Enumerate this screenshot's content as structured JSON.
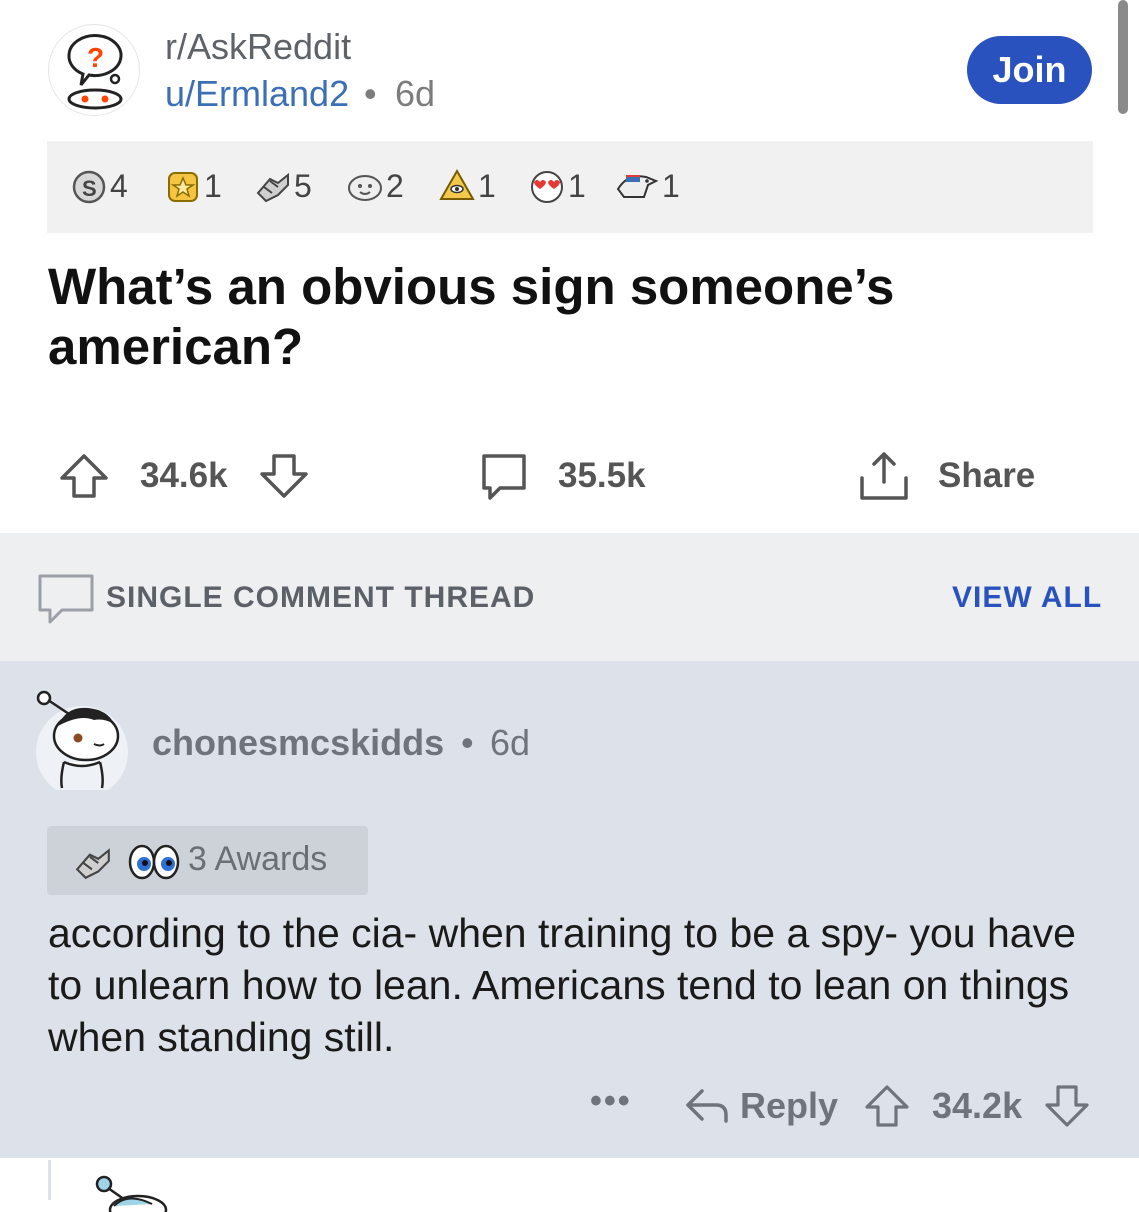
{
  "post": {
    "subreddit": "r/AskReddit",
    "author": "u/Ermland2",
    "separator": "•",
    "age": "6d",
    "join_label": "Join",
    "title": "What’s an obvious sign someone’s american?",
    "awards": [
      {
        "icon": "silver-award-icon",
        "count": "4"
      },
      {
        "icon": "helpful-award-icon",
        "count": "1"
      },
      {
        "icon": "take-my-energy-award-icon",
        "count": "5"
      },
      {
        "icon": "wholesome-award-icon",
        "count": "2"
      },
      {
        "icon": "illuminati-award-icon",
        "count": "1"
      },
      {
        "icon": "heart-eyes-award-icon",
        "count": "1"
      },
      {
        "icon": "eagle-award-icon",
        "count": "1"
      }
    ],
    "votes": "34.6k",
    "comments": "35.5k",
    "share_label": "Share"
  },
  "thread": {
    "label": "SINGLE COMMENT THREAD",
    "view_all": "VIEW ALL"
  },
  "comment": {
    "author": "chonesmcskidds",
    "separator": "•",
    "age": "6d",
    "awards_label": "3 Awards",
    "award_icons": [
      "take-my-energy-award-icon",
      "eyes-award-icon"
    ],
    "text": "according to the cia- when training to be a spy- you have to unlearn how to lean. Americans tend to lean on things when standing still.",
    "more": "•••",
    "reply_label": "Reply",
    "votes": "34.2k"
  },
  "colors": {
    "accent": "#2a52be",
    "comment_bg": "#dde2ea",
    "thread_bg": "#edeff1"
  }
}
